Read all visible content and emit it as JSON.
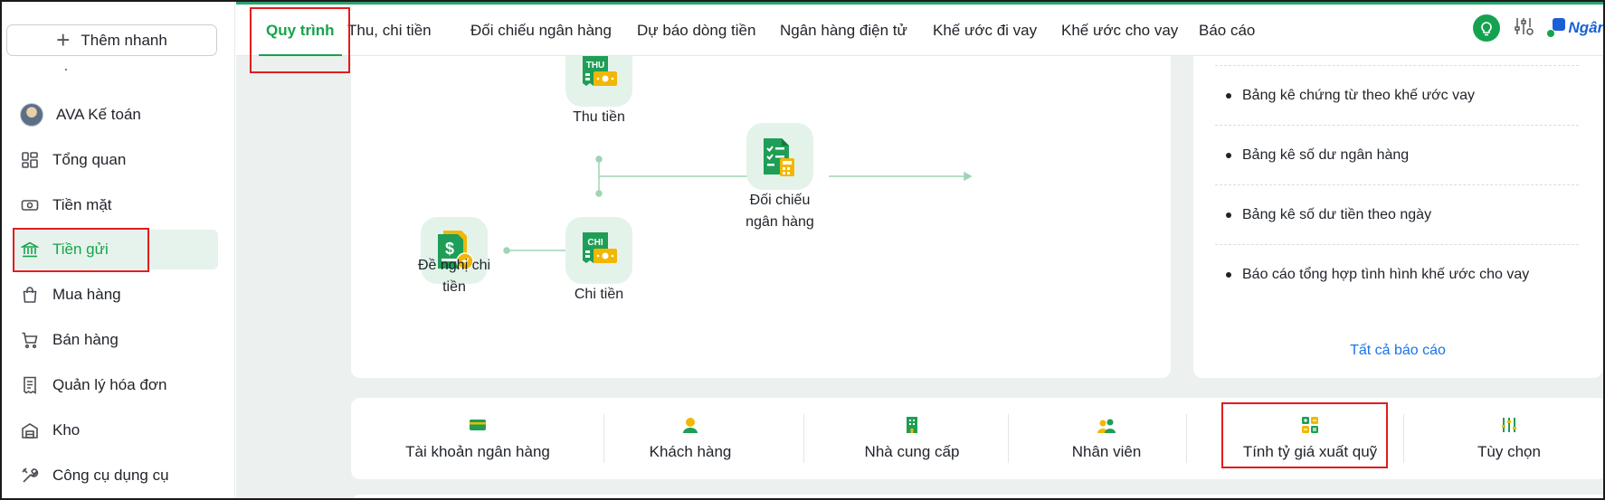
{
  "sidebar": {
    "quick_add_label": "Thêm nhanh",
    "stray_mark": ".",
    "items": [
      {
        "label": "AVA Kế toán"
      },
      {
        "label": "Tổng quan"
      },
      {
        "label": "Tiền mặt"
      },
      {
        "label": "Tiền gửi"
      },
      {
        "label": "Mua hàng"
      },
      {
        "label": "Bán hàng"
      },
      {
        "label": "Quản lý hóa đơn"
      },
      {
        "label": "Kho"
      },
      {
        "label": "Công cụ dụng cụ"
      }
    ],
    "active_item": "Tiền gửi"
  },
  "topbar": {
    "tabs": [
      {
        "label": "Quy trình"
      },
      {
        "label": "Thu, chi tiền"
      },
      {
        "label": "Đối chiếu ngân hàng"
      },
      {
        "label": "Dự báo dòng tiền"
      },
      {
        "label": "Ngân hàng điện tử"
      },
      {
        "label": "Khế ước đi vay"
      },
      {
        "label": "Khế ước cho vay"
      },
      {
        "label": "Báo cáo"
      }
    ],
    "active_tab": "Quy trình",
    "brand_text": "Ngân"
  },
  "process": {
    "thu_badge": "THU",
    "chi_badge": "CHI",
    "nodes": {
      "thu": "Thu tiền",
      "doi_chieu_line1": "Đối chiếu",
      "doi_chieu_line2": "ngân hàng",
      "de_nghi_line1": "Đề nghị chi",
      "de_nghi_line2": "tiền",
      "chi": "Chi tiền"
    }
  },
  "reports": {
    "items": [
      {
        "label": "Bảng kê chứng từ theo khế ước vay"
      },
      {
        "label": "Bảng kê số dư ngân hàng"
      },
      {
        "label": "Bảng kê số dư tiền theo ngày"
      },
      {
        "label": "Báo cáo tổng hợp tình hình khế ước cho vay"
      }
    ],
    "all_link": "Tất cả báo cáo"
  },
  "shortcuts": [
    {
      "label": "Tài khoản ngân hàng",
      "icon": "card-icon"
    },
    {
      "label": "Khách hàng",
      "icon": "person-icon"
    },
    {
      "label": "Nhà cung cấp",
      "icon": "building-icon"
    },
    {
      "label": "Nhân viên",
      "icon": "people-icon"
    },
    {
      "label": "Tính tỷ giá xuất quỹ",
      "icon": "calculator-icon"
    },
    {
      "label": "Tùy chọn",
      "icon": "sliders-icon"
    }
  ],
  "colors": {
    "accent": "#16a34a",
    "highlight": "#e21c1c",
    "link": "#1a73e8"
  }
}
